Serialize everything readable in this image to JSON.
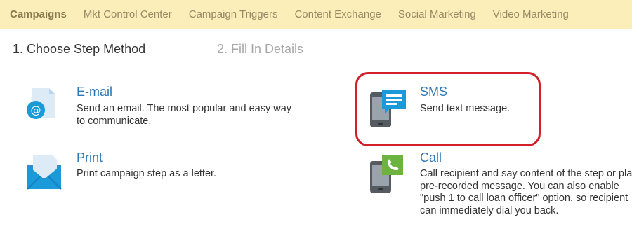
{
  "nav": {
    "items": [
      {
        "label": "Campaigns",
        "active": true
      },
      {
        "label": "Mkt Control Center",
        "active": false
      },
      {
        "label": "Campaign Triggers",
        "active": false
      },
      {
        "label": "Content Exchange",
        "active": false
      },
      {
        "label": "Social Marketing",
        "active": false
      },
      {
        "label": "Video Marketing",
        "active": false
      }
    ]
  },
  "steps": {
    "step1": "1. Choose Step Method",
    "step2": "2. Fill In Details"
  },
  "methods": {
    "email": {
      "title": "E-mail",
      "description": "Send an email. The most popular and easy way to communicate.",
      "icon": "email-document-icon"
    },
    "sms": {
      "title": "SMS",
      "description": "Send text message.",
      "icon": "phone-message-icon"
    },
    "print": {
      "title": "Print",
      "description": "Print campaign step as a letter.",
      "icon": "envelope-letter-icon"
    },
    "call": {
      "title": "Call",
      "description": "Call recipient and say content of the step or play pre-recorded message. You can also enable \"push 1 to call loan officer\" option, so recipient can immediately dial you back.",
      "icon": "phone-call-icon"
    }
  },
  "colors": {
    "nav_bg": "#fbeeb8",
    "link_blue": "#2f78b7",
    "highlight_red": "#d21f28",
    "icon_blue": "#1a9ad9",
    "call_green": "#6cb33f"
  }
}
